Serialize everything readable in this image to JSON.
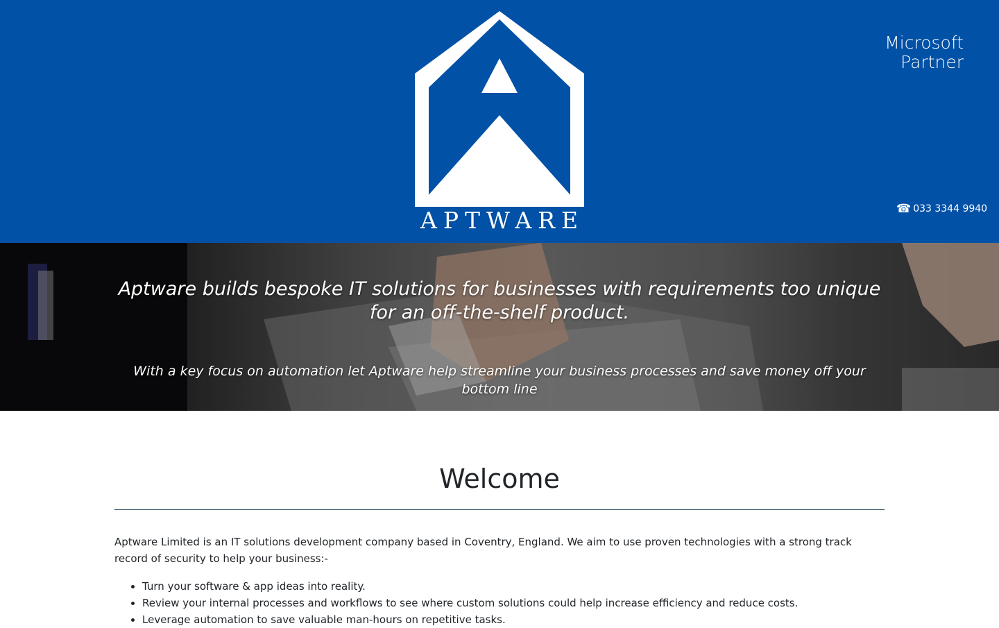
{
  "header": {
    "brand_name": "APTWARE",
    "partner_line1": "Microsoft",
    "partner_line2": "Partner",
    "phone_icon": "phone-icon",
    "phone_number": "033 3344 9940",
    "background_color": "#0151a7"
  },
  "hero": {
    "headline": "Aptware builds bespoke IT solutions for businesses with requirements too unique for an off-the-shelf product.",
    "subheadline": "With a key focus on automation let Aptware help streamline your business processes and save money off your bottom line"
  },
  "main": {
    "title": "Welcome",
    "intro": "Aptware Limited is an IT solutions development company based in Coventry, England. We aim to use proven technologies with a strong track record of security to help your business:-",
    "bullets": [
      "Turn your software & app ideas into reality.",
      "Review your internal processes and workflows to see where custom solutions could help increase efficiency and reduce costs.",
      "Leverage automation to save valuable man-hours on repetitive tasks."
    ]
  }
}
